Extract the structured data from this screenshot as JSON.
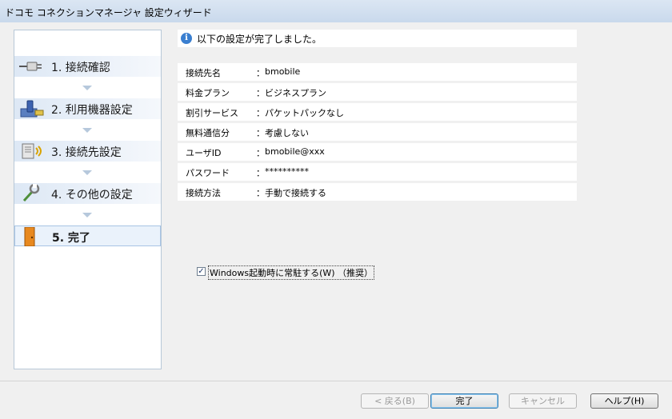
{
  "window": {
    "title": "ドコモ コネクションマネージャ 設定ウィザード"
  },
  "steps": [
    {
      "label": "1. 接続確認",
      "icon": "plug-icon"
    },
    {
      "label": "2. 利用機器設定",
      "icon": "device-icon"
    },
    {
      "label": "3. 接続先設定",
      "icon": "network-icon"
    },
    {
      "label": "4. その他の設定",
      "icon": "wrench-icon"
    },
    {
      "label": "5. 完了",
      "icon": "door-icon",
      "active": true
    }
  ],
  "notice": {
    "text": "以下の設定が完了しました。",
    "icon": "info-icon"
  },
  "settings": [
    {
      "key": "接続先名",
      "sep": "：",
      "value": "bmobile"
    },
    {
      "key": "料金プラン",
      "sep": "：",
      "value": "ビジネスプラン"
    },
    {
      "key": "割引サービス",
      "sep": "：",
      "value": "パケットパックなし"
    },
    {
      "key": "無料通信分",
      "sep": "：",
      "value": "考慮しない"
    },
    {
      "key": "ユーザID",
      "sep": "：",
      "value": "bmobile@xxx"
    },
    {
      "key": "パスワード",
      "sep": "：",
      "value": "**********"
    },
    {
      "key": "接続方法",
      "sep": "：",
      "value": "手動で接続する"
    }
  ],
  "startup_checkbox": {
    "label": "Windows起動時に常駐する(W) （推奨）",
    "checked": true,
    "mark": "✓"
  },
  "buttons": {
    "back": "< 戻る(B)",
    "finish": "完了",
    "cancel": "キャンセル",
    "help": "ヘルプ(H)"
  },
  "colors": {
    "accent": "#3a7fd0",
    "step_bg": "#dde8f5",
    "door": "#e8891f"
  }
}
